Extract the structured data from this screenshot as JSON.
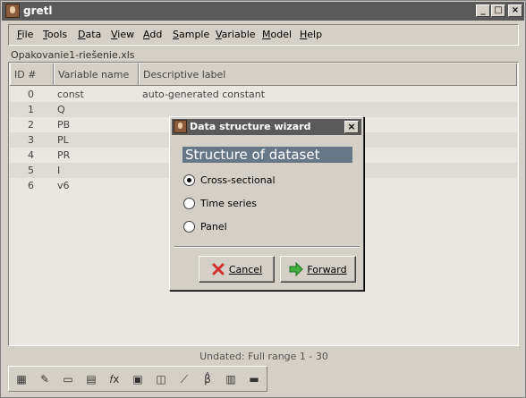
{
  "window": {
    "title": "gretl"
  },
  "menubar": [
    "File",
    "Tools",
    "Data",
    "View",
    "Add",
    "Sample",
    "Variable",
    "Model",
    "Help"
  ],
  "filename": "Opakovanie1-riešenie.xls",
  "columns": {
    "id": "ID #",
    "name": "Variable name",
    "label": "Descriptive label"
  },
  "variables": [
    {
      "id": "0",
      "name": "const",
      "label": "auto-generated constant"
    },
    {
      "id": "1",
      "name": "Q",
      "label": ""
    },
    {
      "id": "2",
      "name": "PB",
      "label": ""
    },
    {
      "id": "3",
      "name": "PL",
      "label": ""
    },
    {
      "id": "4",
      "name": "PR",
      "label": ""
    },
    {
      "id": "5",
      "name": "I",
      "label": ""
    },
    {
      "id": "6",
      "name": "v6",
      "label": ""
    }
  ],
  "status": "Undated: Full range 1 - 30",
  "toolbar_icons": [
    "calculator-icon",
    "edit-script-icon",
    "terminal-icon",
    "session-icons-icon",
    "function-icon",
    "user-guide-icon",
    "help-icon",
    "graph-icon",
    "beta-icon",
    "log-icon",
    "open-folder-icon"
  ],
  "dialog": {
    "title": "Data structure wizard",
    "heading": "Structure of dataset",
    "options": [
      {
        "label": "Cross-sectional",
        "selected": true
      },
      {
        "label": "Time series",
        "selected": false
      },
      {
        "label": "Panel",
        "selected": false
      }
    ],
    "cancel_label": "Cancel",
    "forward_label": "Forward"
  },
  "colors": {
    "titlebar": "#5a5a5a",
    "heading_bg": "#667788",
    "cancel_icon": "#d03030",
    "forward_icon": "#40b040"
  }
}
